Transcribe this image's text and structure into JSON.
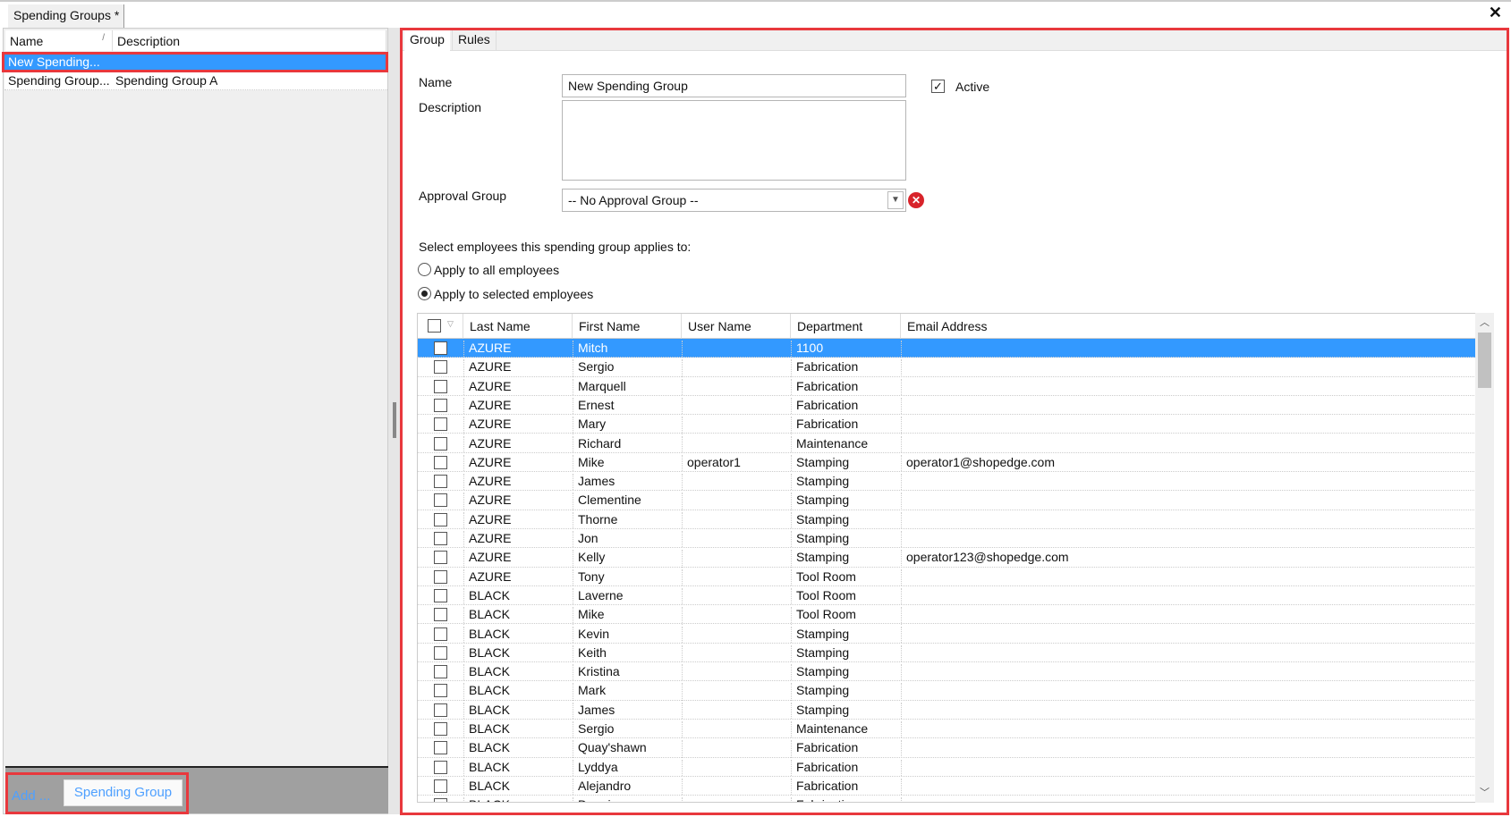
{
  "document_tab": "Spending Groups *",
  "left_panel": {
    "columns": [
      "Name",
      "Description"
    ],
    "rows": [
      {
        "name": "New Spending...",
        "description": "",
        "selected": true
      },
      {
        "name": "Spending Group...",
        "description": "Spending Group A",
        "selected": false
      }
    ],
    "add_label": "Add ...",
    "add_button": "Spending Group"
  },
  "tabs": [
    "Group",
    "Rules"
  ],
  "form": {
    "name_label": "Name",
    "name_value": "New Spending Group",
    "active_label": "Active",
    "active_checked": true,
    "description_label": "Description",
    "description_value": "",
    "approval_label": "Approval Group",
    "approval_value": "-- No Approval Group --",
    "select_label": "Select employees this spending group applies to:",
    "radio_all": "Apply to all employees",
    "radio_selected": "Apply to selected employees",
    "radio_value": "selected"
  },
  "grid": {
    "columns": [
      "Last Name",
      "First Name",
      "User Name",
      "Department",
      "Email Address"
    ],
    "rows": [
      [
        "AZURE",
        "Mitch",
        "",
        "1100",
        ""
      ],
      [
        "AZURE",
        "Sergio",
        "",
        "Fabrication",
        ""
      ],
      [
        "AZURE",
        "Marquell",
        "",
        "Fabrication",
        ""
      ],
      [
        "AZURE",
        "Ernest",
        "",
        "Fabrication",
        ""
      ],
      [
        "AZURE",
        "Mary",
        "",
        "Fabrication",
        ""
      ],
      [
        "AZURE",
        "Richard",
        "",
        "Maintenance",
        ""
      ],
      [
        "AZURE",
        "Mike",
        "operator1",
        "Stamping",
        "operator1@shopedge.com"
      ],
      [
        "AZURE",
        "James",
        "",
        "Stamping",
        ""
      ],
      [
        "AZURE",
        "Clementine",
        "",
        "Stamping",
        ""
      ],
      [
        "AZURE",
        "Thorne",
        "",
        "Stamping",
        ""
      ],
      [
        "AZURE",
        "Jon",
        "",
        "Stamping",
        ""
      ],
      [
        "AZURE",
        "Kelly",
        "",
        "Stamping",
        "operator123@shopedge.com"
      ],
      [
        "AZURE",
        "Tony",
        "",
        "Tool Room",
        ""
      ],
      [
        "BLACK",
        "Laverne",
        "",
        "Tool Room",
        ""
      ],
      [
        "BLACK",
        "Mike",
        "",
        "Tool Room",
        ""
      ],
      [
        "BLACK",
        "Kevin",
        "",
        "Stamping",
        ""
      ],
      [
        "BLACK",
        "Keith",
        "",
        "Stamping",
        ""
      ],
      [
        "BLACK",
        "Kristina",
        "",
        "Stamping",
        ""
      ],
      [
        "BLACK",
        "Mark",
        "",
        "Stamping",
        ""
      ],
      [
        "BLACK",
        "James",
        "",
        "Stamping",
        ""
      ],
      [
        "BLACK",
        "Sergio",
        "",
        "Maintenance",
        ""
      ],
      [
        "BLACK",
        "Quay'shawn",
        "",
        "Fabrication",
        ""
      ],
      [
        "BLACK",
        "Lyddya",
        "",
        "Fabrication",
        ""
      ],
      [
        "BLACK",
        "Alejandro",
        "",
        "Fabrication",
        ""
      ],
      [
        "BLACK",
        "Dennis",
        "",
        "Fabrication",
        ""
      ]
    ]
  },
  "colors": {
    "selection": "#3399ff",
    "highlight": "#e8383d",
    "link": "#4ea0ff"
  }
}
